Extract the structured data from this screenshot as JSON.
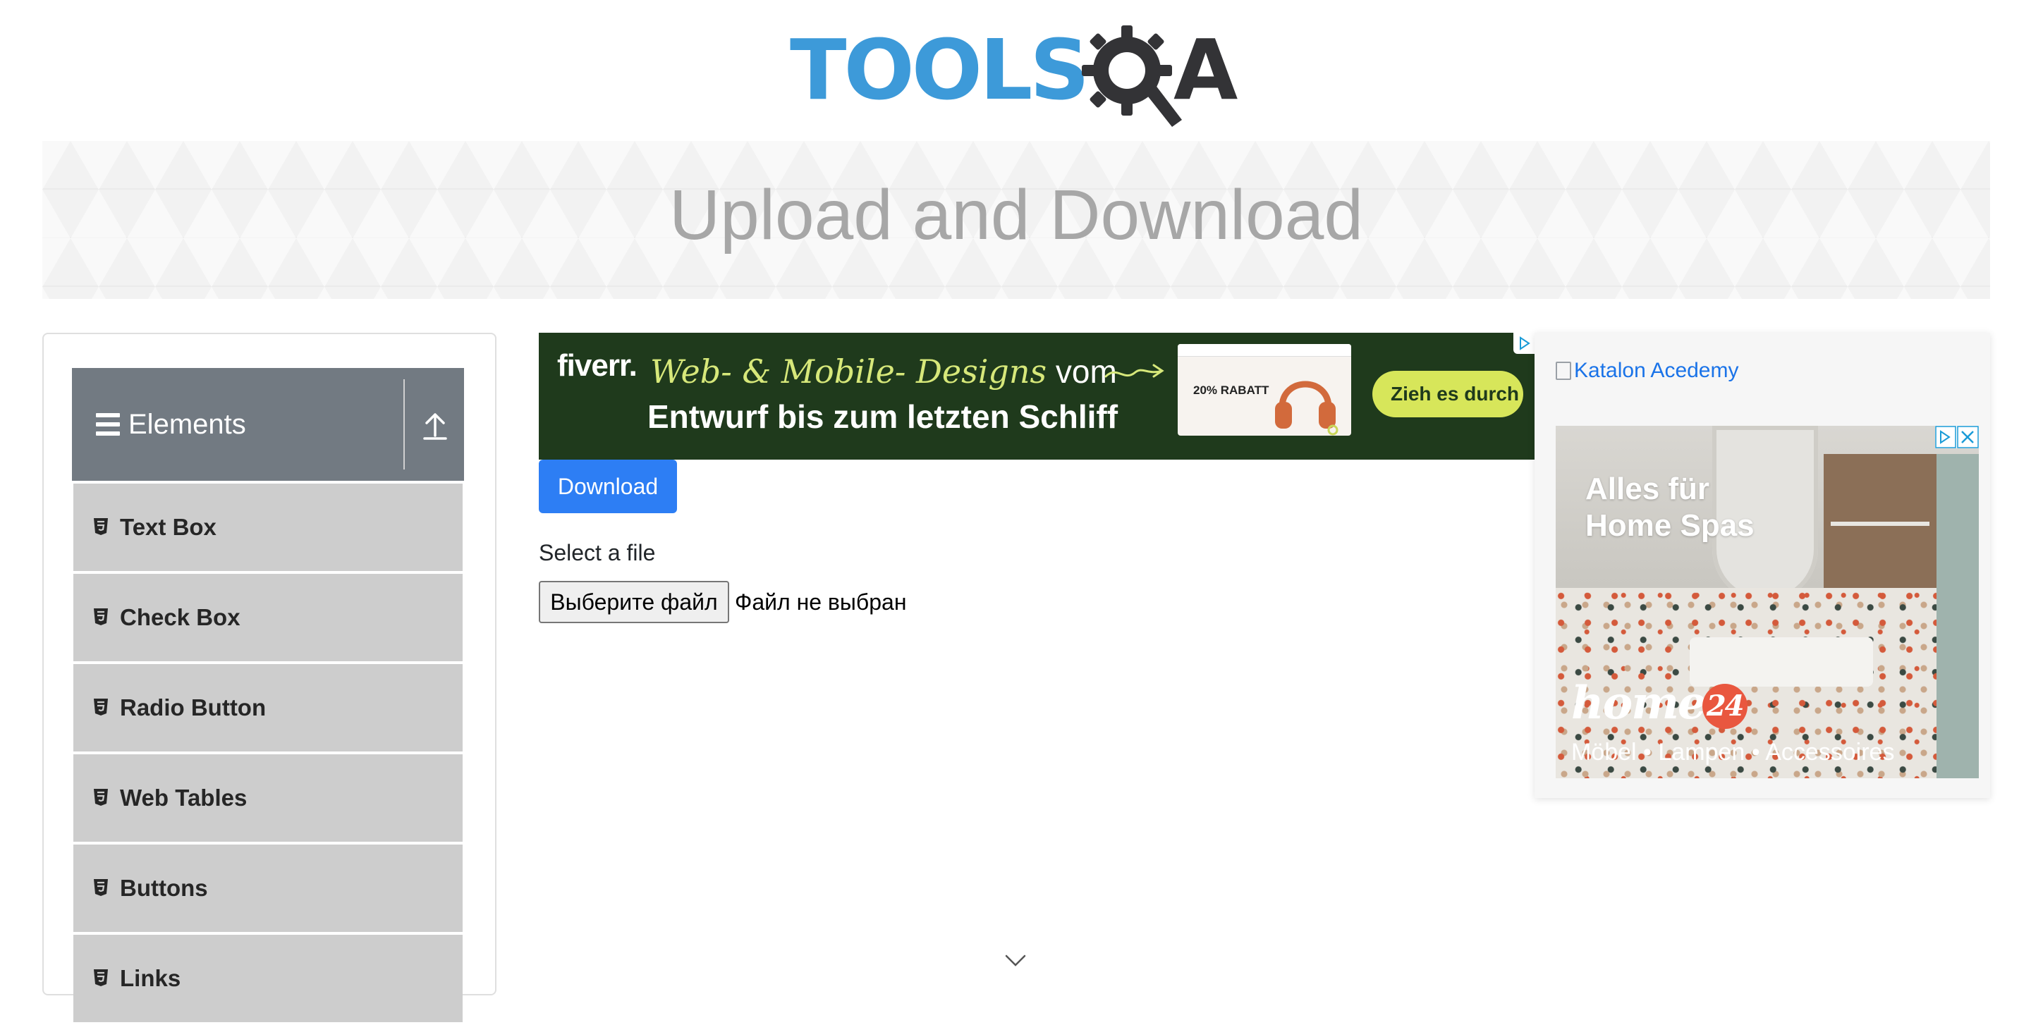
{
  "header": {
    "logo_text_main": "TOOLS",
    "logo_text_accent": "A"
  },
  "banner": {
    "title": "Upload and Download"
  },
  "sidebar": {
    "group_title": "Elements",
    "items": [
      {
        "label": "Text Box"
      },
      {
        "label": "Check Box"
      },
      {
        "label": "Radio Button"
      },
      {
        "label": "Web Tables"
      },
      {
        "label": "Buttons"
      },
      {
        "label": "Links"
      }
    ]
  },
  "ads": {
    "fiverr": {
      "brand": "fiverr.",
      "line1_script": "Web- & Mobile- Designs",
      "line1_rest": "vom",
      "line2": "Entwurf bis zum letzten Schliff",
      "promo": "20% RABATT",
      "cta": "Zieh es durch"
    },
    "katalon": {
      "alt_text": "Katalon Acedemy"
    },
    "home24": {
      "headline": "Alles für\nHome Spas",
      "brand": "home",
      "brand_badge": "24",
      "tagline": "Möbel • Lampen • Accessoires"
    }
  },
  "main": {
    "download_button": "Download",
    "select_label": "Select a file",
    "file_button": "Выберите файл",
    "file_status": "Файл не выбран"
  },
  "colors": {
    "primary_button": "#2d7ef4",
    "sidebar_header": "#727a82",
    "menu_item_bg": "#cdcdcd",
    "logo_blue": "#3d9ad9",
    "logo_dark": "#333336"
  }
}
